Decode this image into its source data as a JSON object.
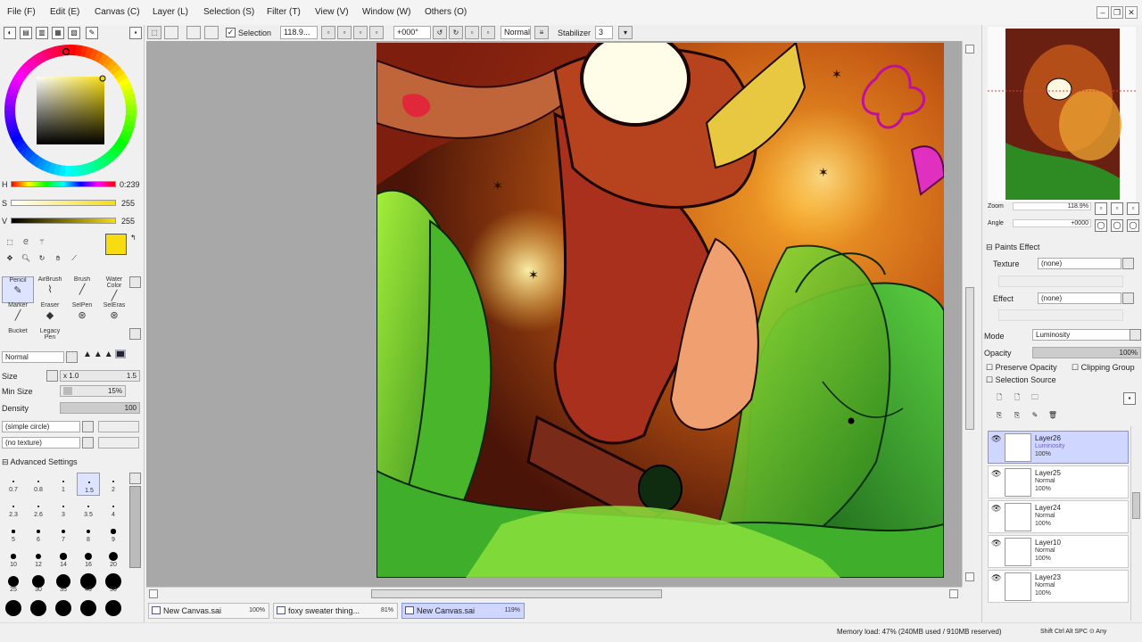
{
  "menu": [
    "File (F)",
    "Edit (E)",
    "Canvas (C)",
    "Layer (L)",
    "Selection (S)",
    "Filter (T)",
    "View (V)",
    "Window (W)",
    "Others (O)"
  ],
  "toolbar": {
    "selection_label": "Selection",
    "zoom_value": "118.9...",
    "angle_value": "+000°",
    "mode_value": "Normal",
    "stabilizer_label": "Stabilizer",
    "stabilizer_value": "3"
  },
  "color": {
    "h_label": "H",
    "h_value": "0:239",
    "s_label": "S",
    "s_value": "255",
    "v_label": "V",
    "v_value": "255",
    "primary": "#f7dd10"
  },
  "tools": [
    {
      "label": "Pencil",
      "glyph": "✎",
      "selected": true
    },
    {
      "label": "AirBrush",
      "glyph": "⌇",
      "selected": false
    },
    {
      "label": "Brush",
      "glyph": "╱",
      "selected": false
    },
    {
      "label": "Water Color",
      "glyph": "╱",
      "selected": false
    },
    {
      "label": "Marker",
      "glyph": "╱",
      "selected": false
    },
    {
      "label": "Eraser",
      "glyph": "◆",
      "selected": false
    },
    {
      "label": "SelPen",
      "glyph": "⊛",
      "selected": false
    },
    {
      "label": "SelEras",
      "glyph": "⊛",
      "selected": false
    },
    {
      "label": "Bucket",
      "glyph": "",
      "selected": false
    },
    {
      "label": "Legacy Pen",
      "glyph": "",
      "selected": false
    }
  ],
  "brush": {
    "mode": "Normal",
    "size_label": "Size",
    "size_multiplier": "x 1.0",
    "size_value": "1.5",
    "min_size_label": "Min Size",
    "min_size_value": "15%",
    "density_label": "Density",
    "density_value": "100",
    "shape": "(simple circle)",
    "texture": "(no texture)",
    "advanced_label": "Advanced Settings",
    "sizes": [
      "0.7",
      "0.8",
      "1",
      "1.5",
      "2",
      "2.3",
      "2.6",
      "3",
      "3.5",
      "4",
      "5",
      "6",
      "7",
      "8",
      "9",
      "10",
      "12",
      "14",
      "16",
      "20",
      "25",
      "30",
      "35",
      "40",
      "50",
      "",
      "",
      "",
      "",
      ""
    ]
  },
  "navigator": {
    "zoom_label": "Zoom",
    "zoom_value": "118.9%",
    "angle_label": "Angle",
    "angle_value": "+0000"
  },
  "paper_effect": {
    "title": "Paints Effect",
    "texture_label": "Texture",
    "texture_value": "(none)",
    "effect_label": "Effect",
    "effect_value": "(none)"
  },
  "layer_props": {
    "mode_label": "Mode",
    "mode_value": "Luminosity",
    "opacity_label": "Opacity",
    "opacity_value": "100%",
    "preserve_opacity": "Preserve Opacity",
    "clipping_group": "Clipping Group",
    "selection_source": "Selection Source"
  },
  "layers": [
    {
      "name": "Layer26",
      "mode": "Luminosity",
      "opacity": "100%",
      "active": true
    },
    {
      "name": "Layer25",
      "mode": "Normal",
      "opacity": "100%",
      "active": false
    },
    {
      "name": "Layer24",
      "mode": "Normal",
      "opacity": "100%",
      "active": false
    },
    {
      "name": "Layer10",
      "mode": "Normal",
      "opacity": "100%",
      "active": false
    },
    {
      "name": "Layer23",
      "mode": "Normal",
      "opacity": "100%",
      "active": false
    }
  ],
  "tabs": [
    {
      "name": "New Canvas.sai",
      "pct": "100%",
      "active": false
    },
    {
      "name": "foxy sweater thing...",
      "pct": "81%",
      "active": false
    },
    {
      "name": "New Canvas.sai",
      "pct": "119%",
      "active": true
    }
  ],
  "status": {
    "memory": "Memory load: 47% (240MB used / 910MB reserved)",
    "keys": "Shift Ctrl Alt SPC ⊙ Any"
  }
}
